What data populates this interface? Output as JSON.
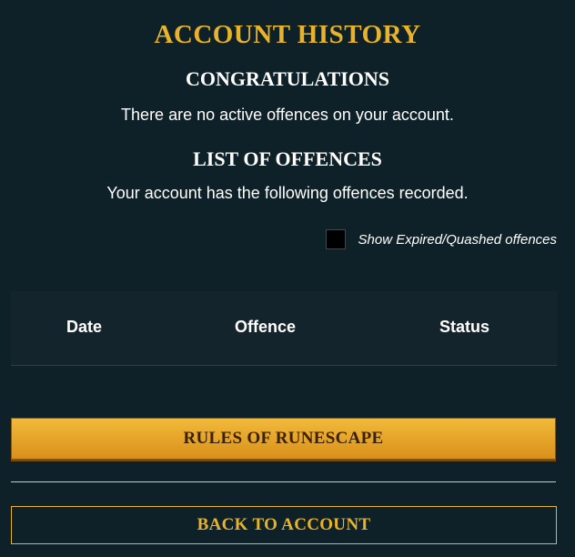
{
  "page": {
    "title": "ACCOUNT HISTORY"
  },
  "congrats": {
    "heading": "CONGRATULATIONS",
    "message": "There are no active offences on your account."
  },
  "offences": {
    "heading": "LIST OF OFFENCES",
    "message": "Your account has the following offences recorded.",
    "filter_label": "Show Expired/Quashed offences",
    "filter_checked": false,
    "columns": [
      "Date",
      "Offence",
      "Status"
    ],
    "rows": []
  },
  "actions": {
    "rules_label": "RULES OF RUNESCAPE",
    "back_label": "BACK TO ACCOUNT"
  },
  "colors": {
    "background": "#0f2128",
    "accent_gold": "#e8b32a",
    "table_header": "#13242c",
    "button_gradient_top": "#f2ba3a",
    "button_gradient_bottom": "#d9901a"
  }
}
